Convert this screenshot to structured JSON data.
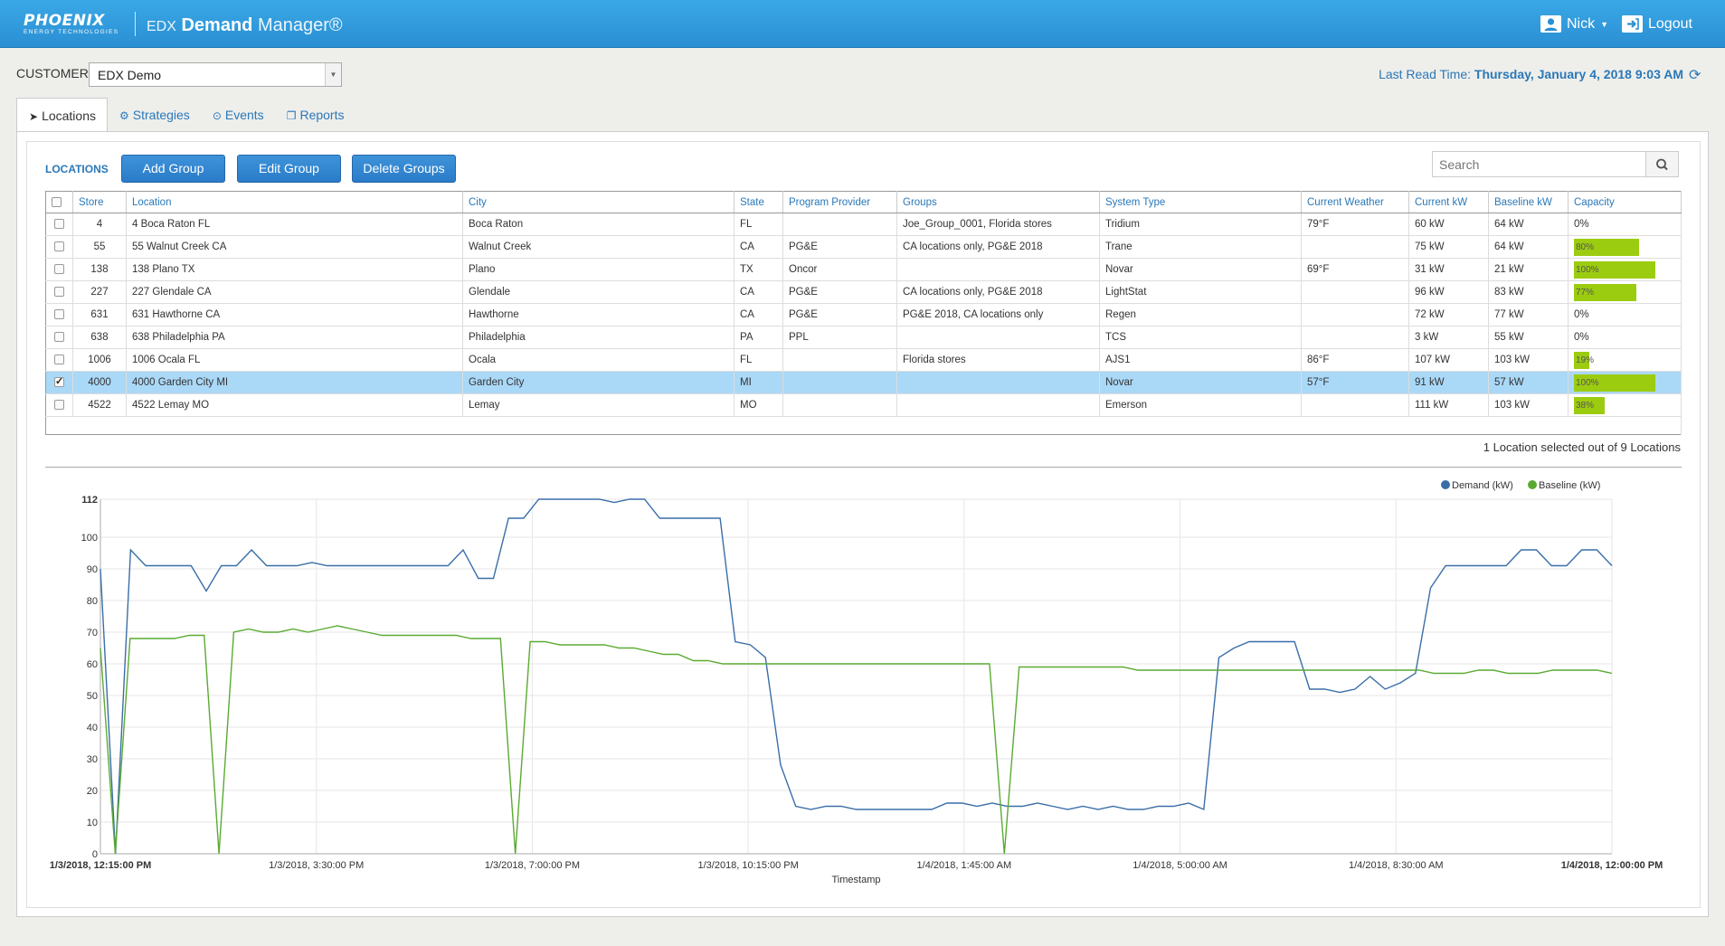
{
  "header": {
    "brand_name": "PHOENIX",
    "brand_sub": "ENERGY TECHNOLOGIES",
    "app_prefix": "EDX",
    "app_name": "Demand",
    "app_suffix": "Manager®",
    "user_name": "Nick",
    "logout_label": "Logout",
    "colors": {
      "bar": "#2a8fd3",
      "link": "#2a78b8"
    }
  },
  "customer": {
    "label": "CUSTOMER",
    "selected": "EDX Demo"
  },
  "last_read": {
    "label": "Last Read Time:",
    "value": "Thursday, January 4, 2018 9:03 AM"
  },
  "tabs": [
    {
      "label": "Locations",
      "icon": "location-arrow-icon",
      "active": true
    },
    {
      "label": "Strategies",
      "icon": "gear-icon"
    },
    {
      "label": "Events",
      "icon": "clock-icon"
    },
    {
      "label": "Reports",
      "icon": "copy-icon"
    }
  ],
  "locations": {
    "title": "LOCATIONS",
    "buttons": {
      "add_group": "Add Group",
      "edit_group": "Edit Group",
      "delete_groups": "Delete Groups"
    },
    "search_placeholder": "Search",
    "columns": [
      "Store",
      "Location",
      "City",
      "State",
      "Program Provider",
      "Groups",
      "System Type",
      "Current Weather",
      "Current kW",
      "Baseline kW",
      "Capacity"
    ],
    "rows": [
      {
        "checked": false,
        "store": "4",
        "location": "4 Boca Raton FL",
        "city": "Boca Raton",
        "state": "FL",
        "provider": "",
        "groups": "Joe_Group_0001, Florida stores",
        "system": "Tridium",
        "weather": "79°F",
        "current_kw": "60 kW",
        "baseline_kw": "64 kW",
        "capacity": "0%",
        "capacity_value": 0
      },
      {
        "checked": false,
        "store": "55",
        "location": "55 Walnut Creek CA",
        "city": "Walnut Creek",
        "state": "CA",
        "provider": "PG&E",
        "groups": "CA locations only, PG&E 2018",
        "system": "Trane",
        "weather": "",
        "current_kw": "75 kW",
        "baseline_kw": "64 kW",
        "capacity": "80%",
        "capacity_value": 80
      },
      {
        "checked": false,
        "store": "138",
        "location": "138 Plano TX",
        "city": "Plano",
        "state": "TX",
        "provider": "Oncor",
        "groups": "",
        "system": "Novar",
        "weather": "69°F",
        "current_kw": "31 kW",
        "baseline_kw": "21 kW",
        "capacity": "100%",
        "capacity_value": 100
      },
      {
        "checked": false,
        "store": "227",
        "location": "227 Glendale CA",
        "city": "Glendale",
        "state": "CA",
        "provider": "PG&E",
        "groups": "CA locations only, PG&E 2018",
        "system": "LightStat",
        "weather": "",
        "current_kw": "96 kW",
        "baseline_kw": "83 kW",
        "capacity": "77%",
        "capacity_value": 77
      },
      {
        "checked": false,
        "store": "631",
        "location": "631 Hawthorne CA",
        "city": "Hawthorne",
        "state": "CA",
        "provider": "PG&E",
        "groups": "PG&E 2018, CA locations only",
        "system": "Regen",
        "weather": "",
        "current_kw": "72 kW",
        "baseline_kw": "77 kW",
        "capacity": "0%",
        "capacity_value": 0
      },
      {
        "checked": false,
        "store": "638",
        "location": "638 Philadelphia PA",
        "city": "Philadelphia",
        "state": "PA",
        "provider": "PPL",
        "groups": "",
        "system": "TCS",
        "weather": "",
        "current_kw": "3 kW",
        "baseline_kw": "55 kW",
        "capacity": "0%",
        "capacity_value": 0
      },
      {
        "checked": false,
        "store": "1006",
        "location": "1006 Ocala FL",
        "city": "Ocala",
        "state": "FL",
        "provider": "",
        "groups": "Florida stores",
        "system": "AJS1",
        "weather": "86°F",
        "current_kw": "107 kW",
        "baseline_kw": "103 kW",
        "capacity": "19%",
        "capacity_value": 19
      },
      {
        "checked": true,
        "store": "4000",
        "location": "4000 Garden City MI",
        "city": "Garden City",
        "state": "MI",
        "provider": "",
        "groups": "",
        "system": "Novar",
        "weather": "57°F",
        "current_kw": "91 kW",
        "baseline_kw": "57 kW",
        "capacity": "100%",
        "capacity_value": 100
      },
      {
        "checked": false,
        "store": "4522",
        "location": "4522 Lemay MO",
        "city": "Lemay",
        "state": "MO",
        "provider": "",
        "groups": "",
        "system": "Emerson",
        "weather": "",
        "current_kw": "111 kW",
        "baseline_kw": "103 kW",
        "capacity": "38%",
        "capacity_value": 38
      }
    ],
    "summary": "1 Location selected out of 9 Locations"
  },
  "chart_data": {
    "type": "line",
    "xlabel": "Timestamp",
    "ylabel": "",
    "ylim": [
      0,
      112
    ],
    "yticks": [
      0,
      10,
      20,
      30,
      40,
      50,
      60,
      70,
      80,
      90,
      100,
      112
    ],
    "x_tick_labels": [
      "1/3/2018, 12:15:00 PM",
      "1/3/2018, 3:30:00 PM",
      "1/3/2018, 7:00:00 PM",
      "1/3/2018, 10:15:00 PM",
      "1/4/2018, 1:45:00 AM",
      "1/4/2018, 5:00:00 AM",
      "1/4/2018, 8:30:00 AM",
      "1/4/2018, 12:00:00 PM"
    ],
    "x_start": "1/3/2018, 12:15:00 PM",
    "x_end": "1/4/2018, 12:00:00 PM",
    "grid": true,
    "legend_position": "top-right",
    "series": [
      {
        "name": "Demand (kW)",
        "color": "#3a6ea8",
        "values": [
          90,
          0,
          96,
          91,
          91,
          91,
          91,
          83,
          91,
          91,
          96,
          91,
          91,
          91,
          92,
          91,
          91,
          91,
          91,
          91,
          91,
          91,
          91,
          91,
          96,
          87,
          87,
          106,
          106,
          112,
          112,
          112,
          112,
          112,
          111,
          112,
          112,
          106,
          106,
          106,
          106,
          106,
          67,
          66,
          62,
          28,
          15,
          14,
          15,
          15,
          14,
          14,
          14,
          14,
          14,
          14,
          16,
          16,
          15,
          16,
          15,
          15,
          16,
          15,
          14,
          15,
          14,
          15,
          14,
          14,
          15,
          15,
          16,
          14,
          62,
          65,
          67,
          67,
          67,
          67,
          52,
          52,
          51,
          52,
          56,
          52,
          54,
          57,
          84,
          91,
          91,
          91,
          91,
          91,
          96,
          96,
          91,
          91,
          96,
          96,
          91
        ]
      },
      {
        "name": "Baseline (kW)",
        "color": "#5aaa32",
        "values": [
          65,
          0,
          68,
          68,
          68,
          68,
          69,
          69,
          0,
          70,
          71,
          70,
          70,
          71,
          70,
          71,
          72,
          71,
          70,
          69,
          69,
          69,
          69,
          69,
          69,
          68,
          68,
          68,
          0,
          67,
          67,
          66,
          66,
          66,
          66,
          65,
          65,
          64,
          63,
          63,
          61,
          61,
          60,
          60,
          60,
          60,
          60,
          60,
          60,
          60,
          60,
          60,
          60,
          60,
          60,
          60,
          60,
          60,
          60,
          60,
          60,
          0,
          59,
          59,
          59,
          59,
          59,
          59,
          59,
          59,
          58,
          58,
          58,
          58,
          58,
          58,
          58,
          58,
          58,
          58,
          58,
          58,
          58,
          58,
          58,
          58,
          58,
          58,
          58,
          58,
          57,
          57,
          57,
          58,
          58,
          57,
          57,
          57,
          58,
          58,
          58,
          58,
          57
        ]
      }
    ]
  }
}
